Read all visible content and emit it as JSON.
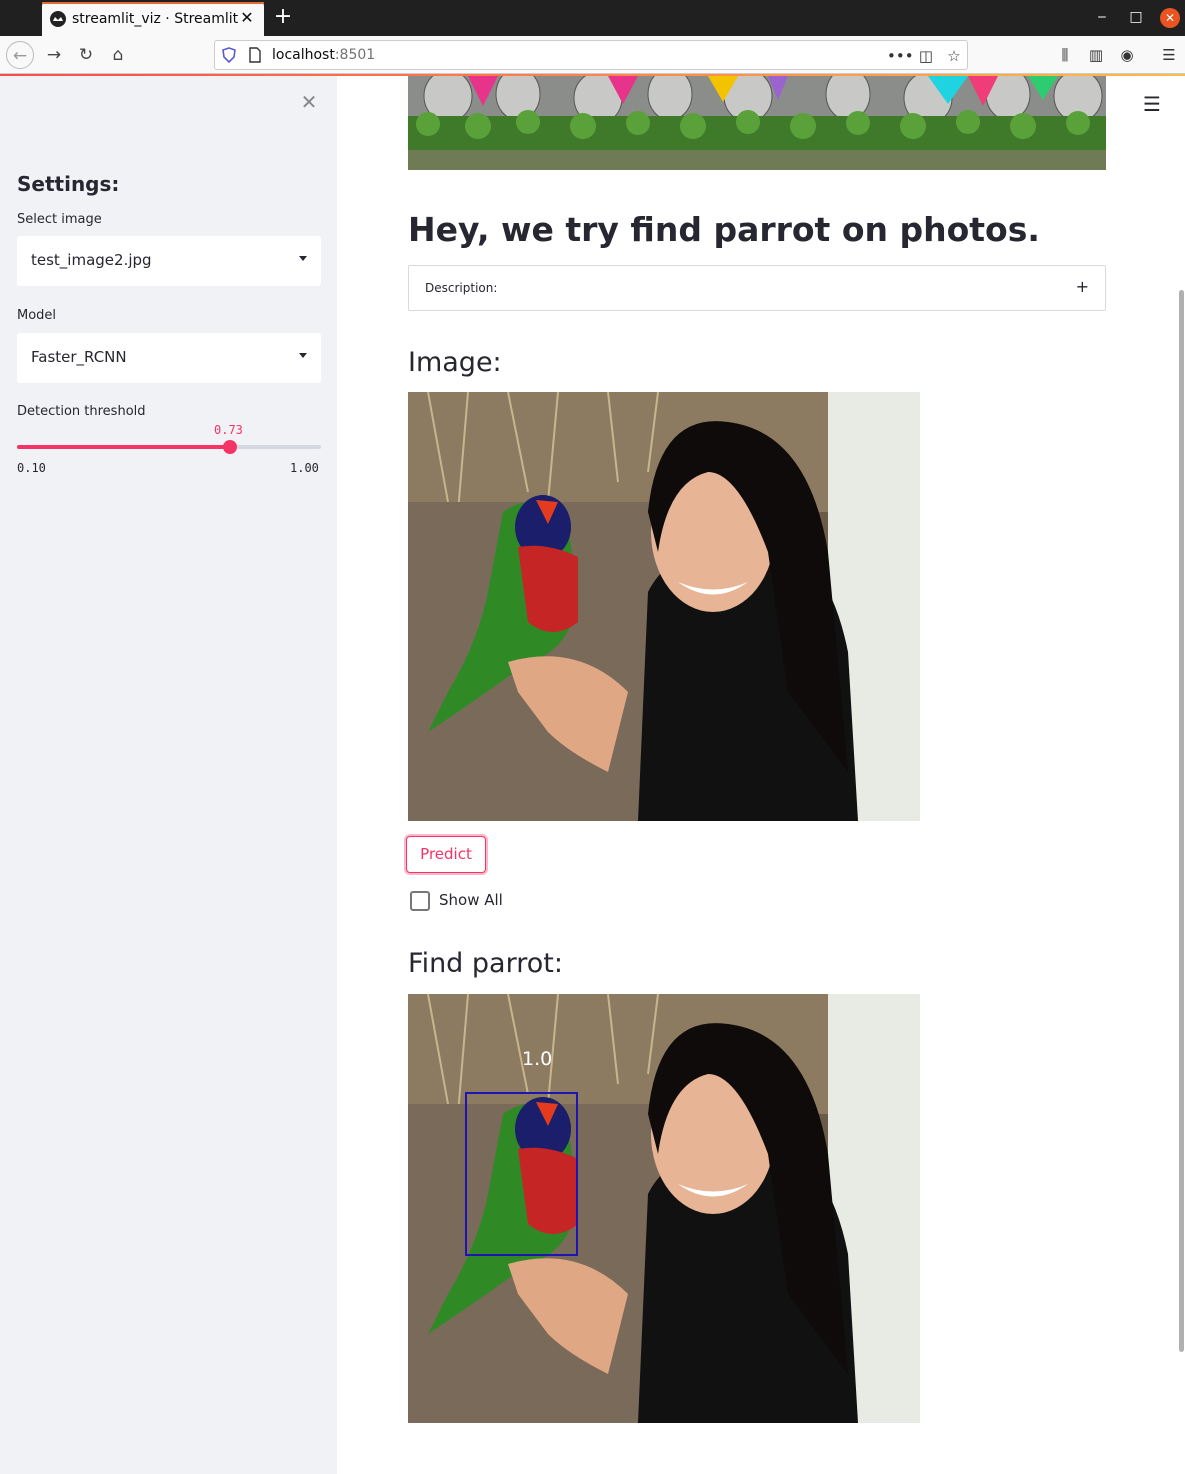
{
  "browser": {
    "tab_title": "streamlit_viz · Streamlit",
    "url_host": "localhost",
    "url_port": ":8501"
  },
  "sidebar": {
    "heading": "Settings:",
    "select_image": {
      "label": "Select image",
      "value": "test_image2.jpg"
    },
    "model": {
      "label": "Model",
      "value": "Faster_RCNN"
    },
    "threshold": {
      "label": "Detection threshold",
      "value": "0.73",
      "min": "0.10",
      "max": "1.00",
      "fraction": 0.7
    }
  },
  "main": {
    "title": "Hey, we try find parrot on photos.",
    "expander_label": "Description:",
    "expander_icon": "plus-icon",
    "image_heading": "Image:",
    "predict_label": "Predict",
    "show_all_label": "Show All",
    "show_all_checked": false,
    "result_heading": "Find parrot:",
    "detection_score": "1.0"
  },
  "colors": {
    "accent": "#f63366",
    "sidebar_bg": "#f0f2f6",
    "text": "#262730",
    "bbox": "#1d14b3"
  }
}
